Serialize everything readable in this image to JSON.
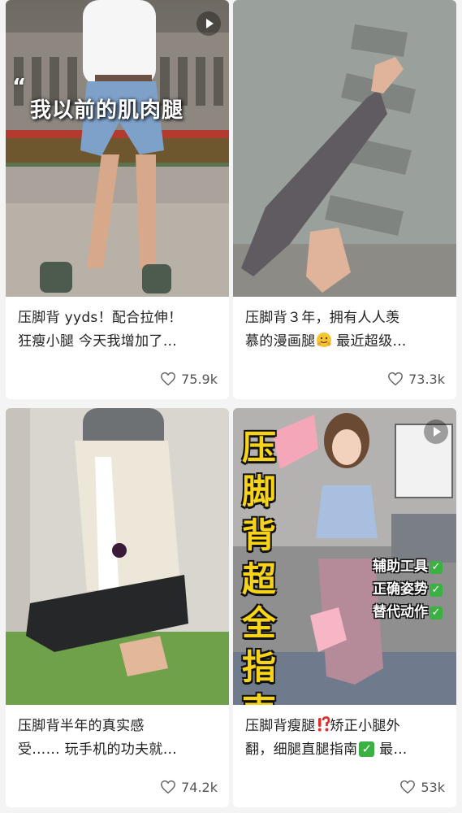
{
  "cards": [
    {
      "overlay_text": "我以前的肌肉腿",
      "caption_line1": "压脚背 yyds！配合拉伸！",
      "caption_line2": "狂瘦小腿 今天我增加了…",
      "likes": "75.9k",
      "has_video_icon": true
    },
    {
      "caption_line1": "压脚背３年，拥有人人羡",
      "caption_line2_a": "慕的漫画腿",
      "caption_line2_b": " 最近超级…",
      "likes": "73.3k",
      "has_video_icon": false
    },
    {
      "caption_line1": "压脚背半年的真实感",
      "caption_line2": "受…… 玩手机的功夫就…",
      "likes": "74.2k",
      "has_video_icon": false
    },
    {
      "title_chars": [
        "压",
        "脚",
        "背",
        "超",
        "全",
        "指",
        "南"
      ],
      "tags": [
        "辅助工具",
        "正确姿势",
        "替代动作"
      ],
      "caption_line1_a": "压脚背瘦腿",
      "caption_line1_b": "矫正小腿外",
      "caption_line2_a": "翻，细腿直腿指南",
      "caption_line2_b": " 最…",
      "likes": "53k",
      "has_video_icon": true
    }
  ],
  "colors": {
    "background": "#f4f4f4",
    "card": "#ffffff",
    "caption_text": "#222222",
    "likes_text": "#555555",
    "title_yellow": "#f7d417",
    "check_green": "#3bb143",
    "warning_red": "#e0302e"
  }
}
